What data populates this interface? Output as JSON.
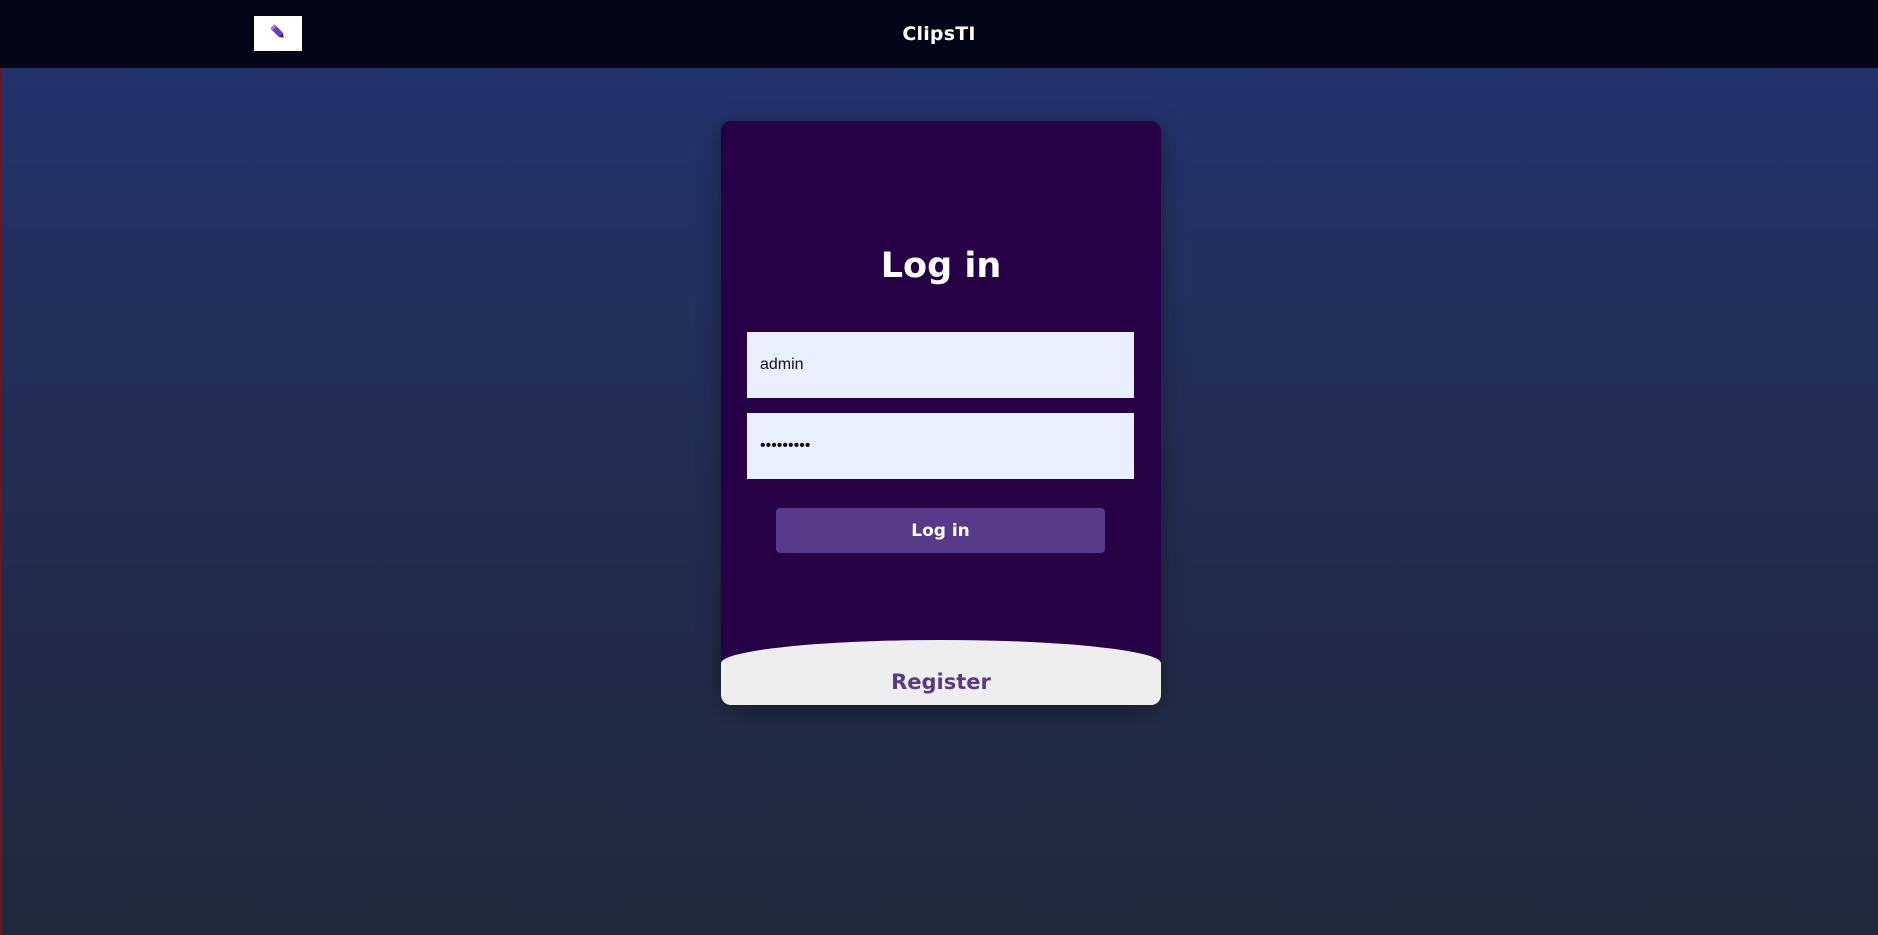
{
  "header": {
    "title": "ClipsTI",
    "logo_icon": "pencil-icon"
  },
  "login_card": {
    "heading": "Log in",
    "username": {
      "value": "admin",
      "placeholder": ""
    },
    "password": {
      "value": "•••••••••",
      "placeholder": ""
    },
    "submit_label": "Log in",
    "register_label": "Register"
  },
  "colors": {
    "topbar": "#030616",
    "card_background": "#270146",
    "input_background": "#e8f0fe",
    "button_background": "#573b8a",
    "register_text": "#573b8a",
    "register_panel": "#eeeeee",
    "page_gradient_top": "#223270",
    "page_gradient_bottom": "#1f2a3c"
  }
}
